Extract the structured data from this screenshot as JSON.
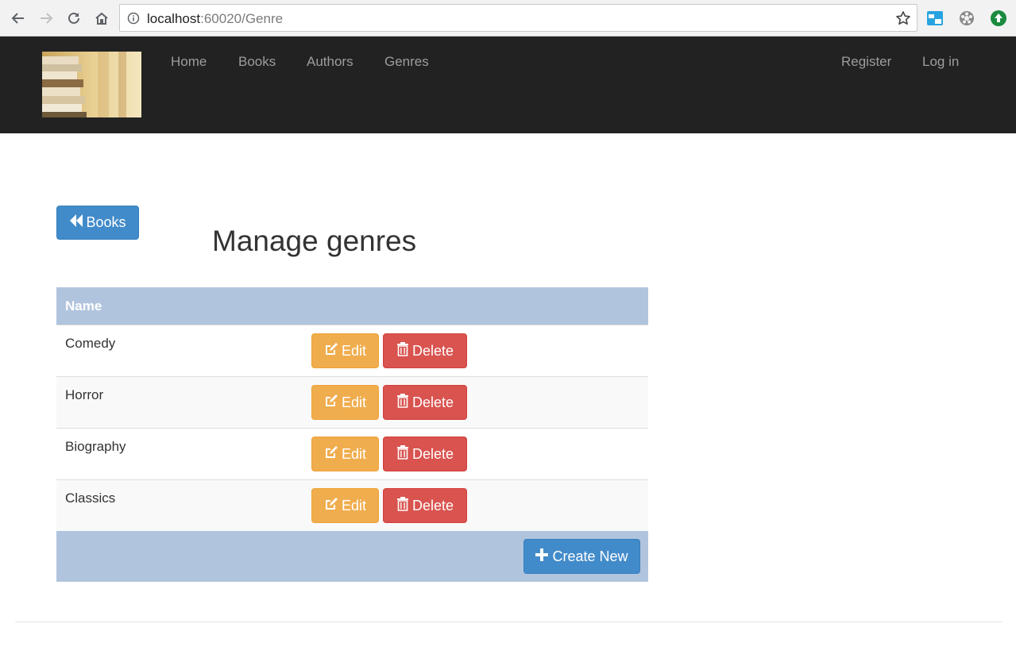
{
  "browser": {
    "url_host": "localhost",
    "url_path": ":60020/Genre",
    "extensions": [
      "window-extension-icon",
      "film-reel-extension-icon",
      "green-upload-extension-icon"
    ]
  },
  "navbar": {
    "links": [
      "Home",
      "Books",
      "Authors",
      "Genres"
    ],
    "right_links": [
      "Register",
      "Log in"
    ]
  },
  "main": {
    "back_label": "Books",
    "title": "Manage genres",
    "table": {
      "header": "Name",
      "rows": [
        {
          "name": "Comedy",
          "edit": "Edit",
          "delete": "Delete"
        },
        {
          "name": "Horror",
          "edit": "Edit",
          "delete": "Delete"
        },
        {
          "name": "Biography",
          "edit": "Edit",
          "delete": "Delete"
        },
        {
          "name": "Classics",
          "edit": "Edit",
          "delete": "Delete"
        }
      ],
      "create_label": "Create New"
    }
  },
  "colors": {
    "navbar": "#222222",
    "primary": "#428bca",
    "warning": "#f0ad4e",
    "danger": "#d9534f",
    "table_header": "#b0c4de"
  }
}
